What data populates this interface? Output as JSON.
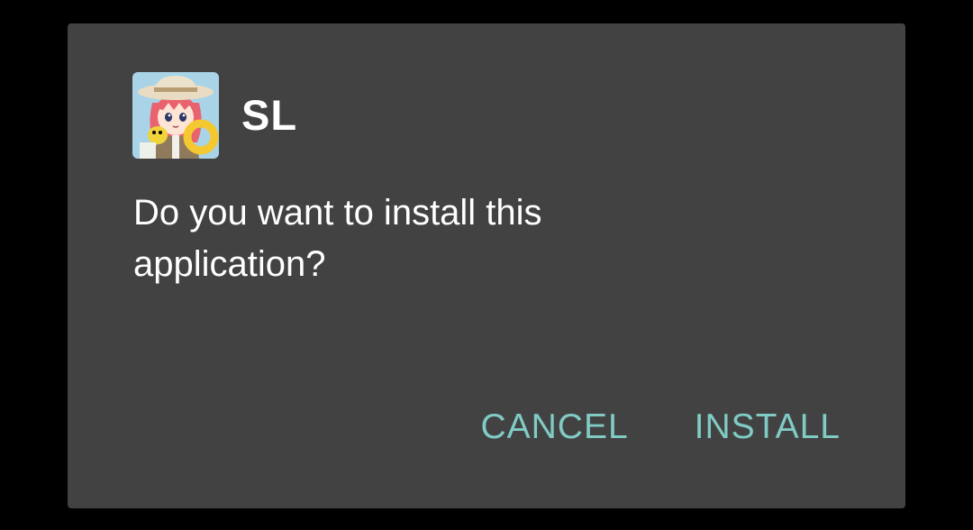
{
  "dialog": {
    "app_icon": "anime-character-app-icon",
    "app_name": "SL",
    "message": "Do you want to install this application?",
    "cancel_label": "CANCEL",
    "install_label": "INSTALL"
  },
  "colors": {
    "background": "#000000",
    "dialog": "#424242",
    "text": "#ffffff",
    "accent": "#80cbc4"
  }
}
